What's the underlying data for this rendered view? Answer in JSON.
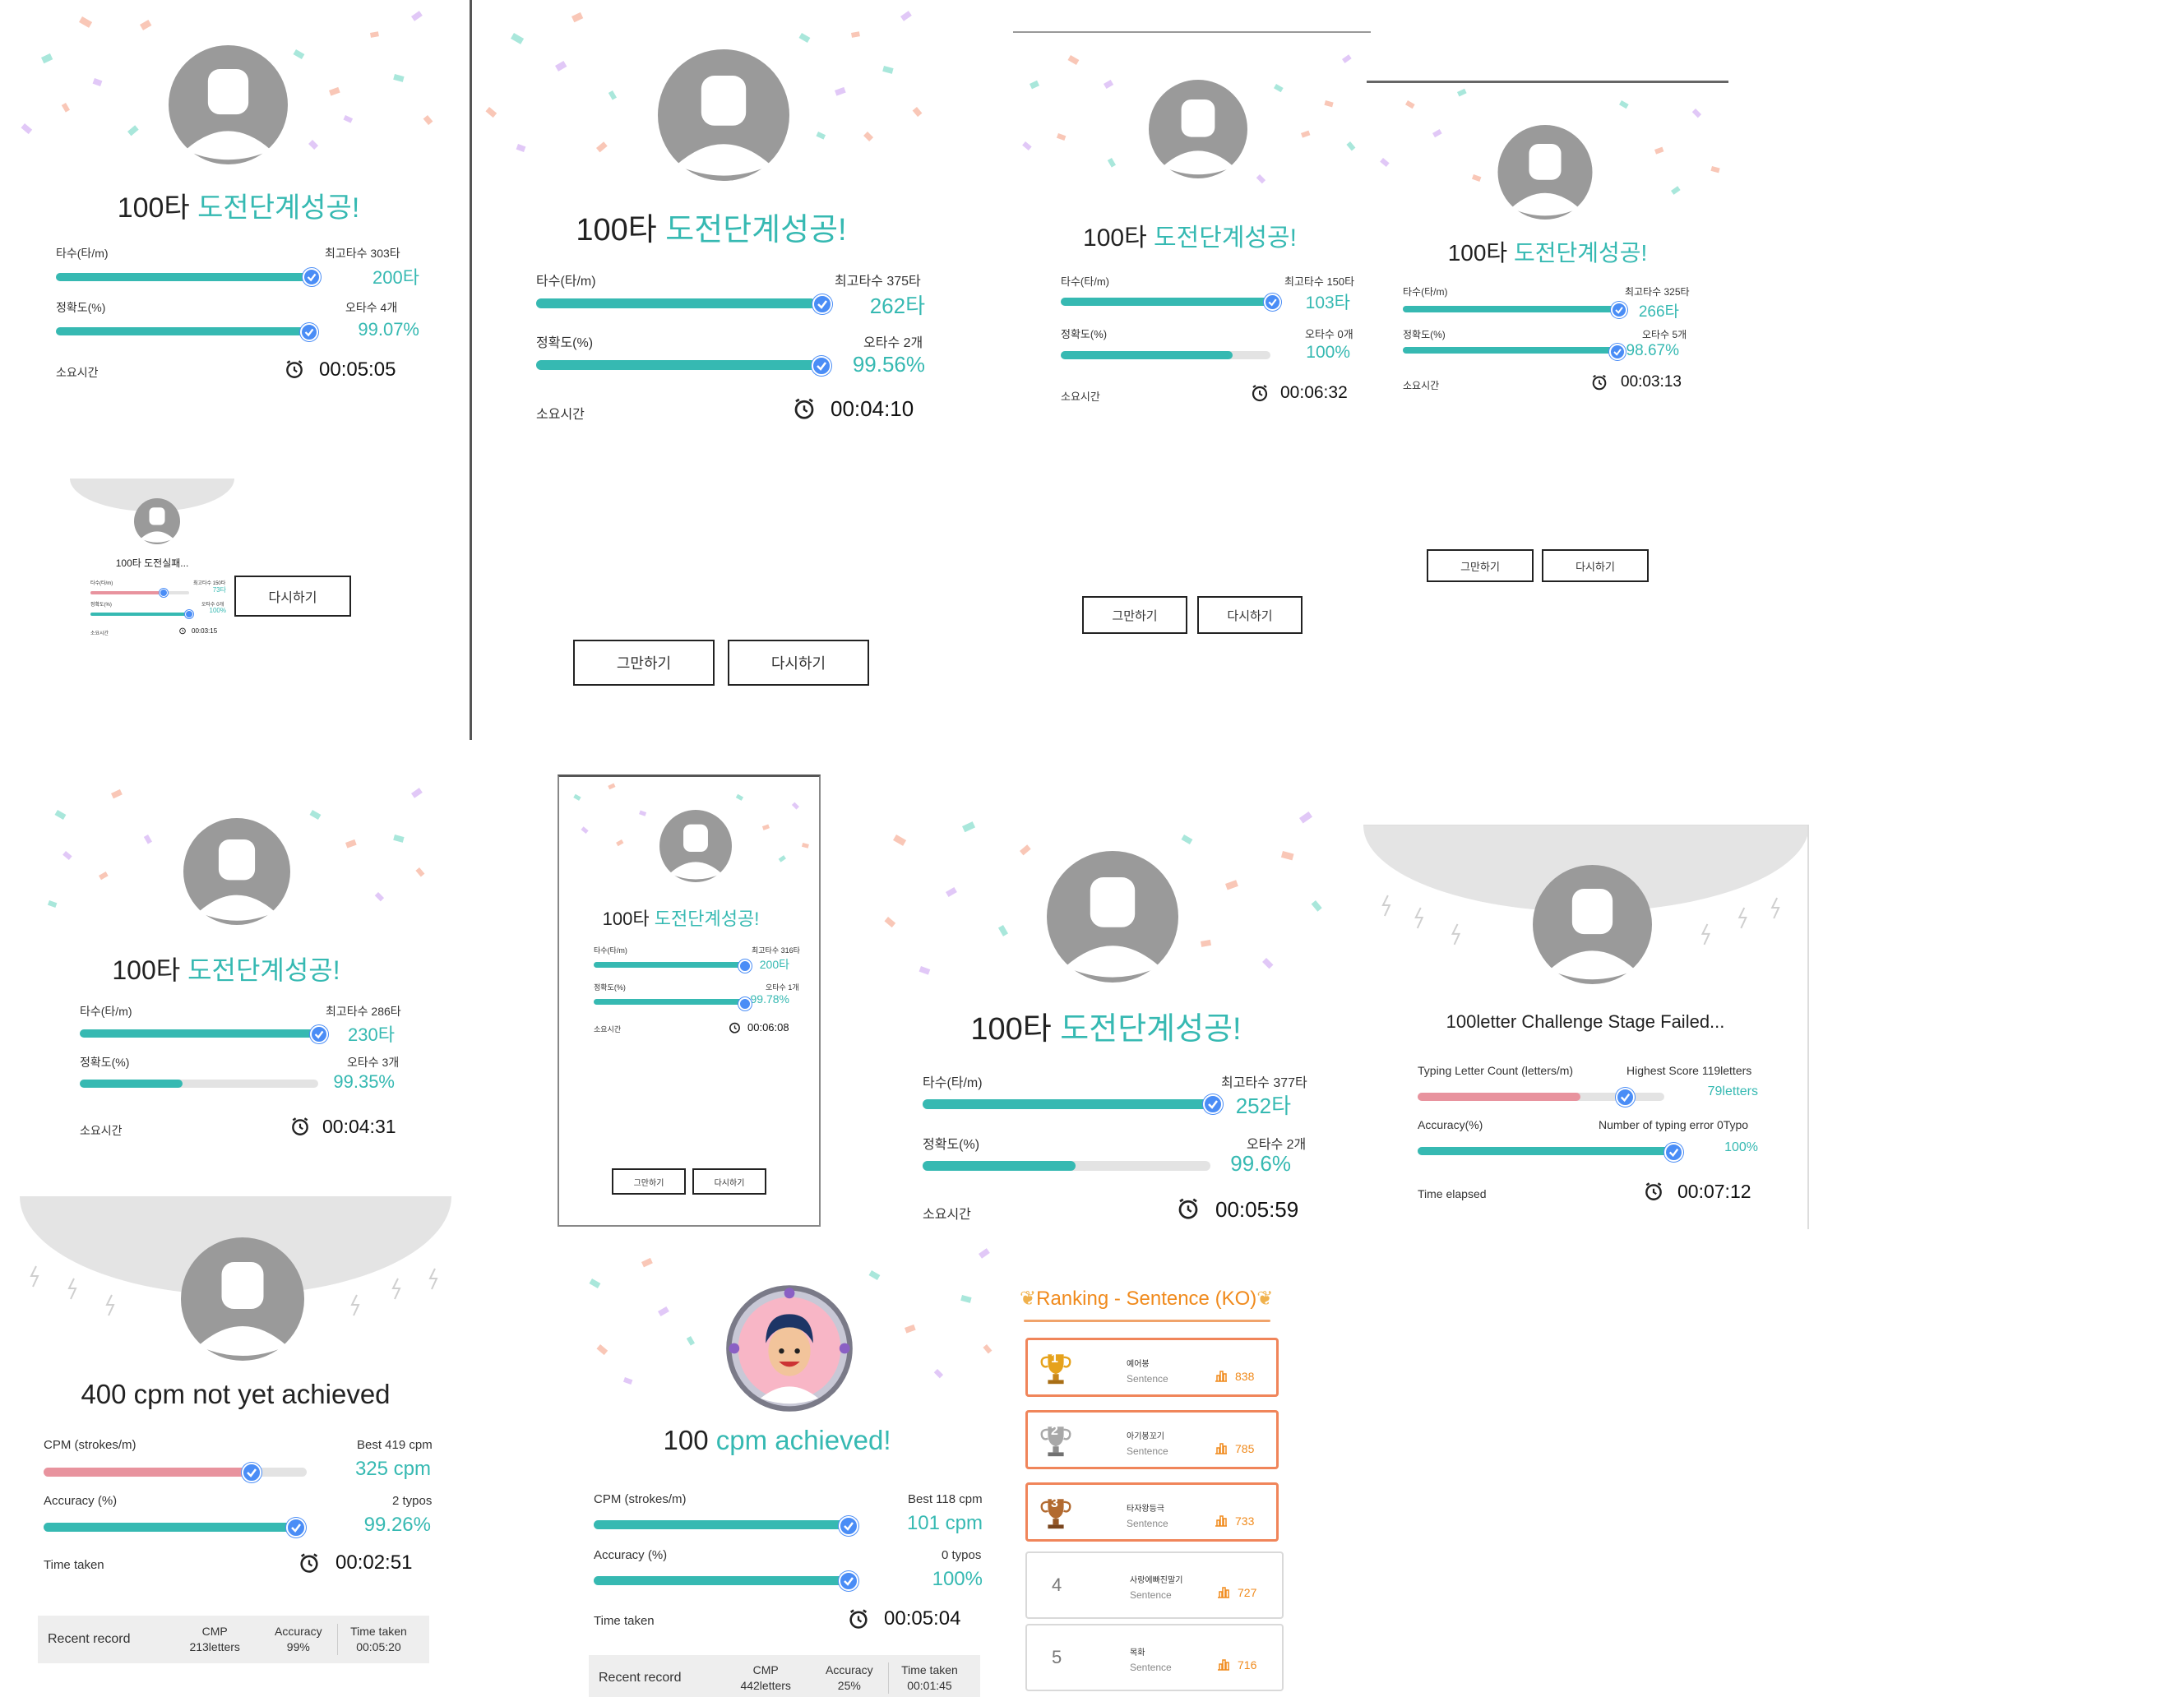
{
  "colors": {
    "accent": "#36b9b2",
    "fail_bar": "#e8939e",
    "check": "#4a8df6",
    "ranking": "#f08a1c"
  },
  "icons": {
    "avatar": "user-avatar-icon",
    "check": "check-circle-icon",
    "clock": "alarm-clock-icon",
    "trophy": "trophy-icon",
    "score": "bar-chart-icon"
  },
  "panels": [
    {
      "id": "ko-success-1",
      "headline_num": "100타",
      "headline_text": "도전단계성공!",
      "speed_label": "타수(타/m)",
      "speed_hint": "최고타수 303타",
      "speed_value": "200타",
      "speed_fill": 1.0,
      "acc_label": "정확도(%)",
      "acc_hint": "오타수 4개",
      "acc_value": "99.07%",
      "acc_fill": 1.0,
      "time_label": "소요시간",
      "time_value": "00:05:05"
    },
    {
      "id": "ko-success-2",
      "headline_num": "100타",
      "headline_text": "도전단계성공!",
      "speed_label": "타수(타/m)",
      "speed_hint": "최고타수 375타",
      "speed_value": "262타",
      "speed_fill": 1.0,
      "acc_label": "정확도(%)",
      "acc_hint": "오타수 2개",
      "acc_value": "99.56%",
      "acc_fill": 1.0,
      "time_label": "소요시간",
      "time_value": "00:04:10",
      "btn_quit": "그만하기",
      "btn_retry": "다시하기"
    },
    {
      "id": "ko-success-3",
      "headline_num": "100타",
      "headline_text": "도전단계성공!",
      "speed_label": "타수(타/m)",
      "speed_hint": "최고타수 150타",
      "speed_value": "103타",
      "speed_fill": 1.0,
      "acc_label": "정확도(%)",
      "acc_hint": "오타수 0개",
      "acc_value": "100%",
      "acc_fill": 0.82,
      "time_label": "소요시간",
      "time_value": "00:06:32",
      "btn_quit": "그만하기",
      "btn_retry": "다시하기"
    },
    {
      "id": "ko-success-4",
      "headline_num": "100타",
      "headline_text": "도전단계성공!",
      "speed_label": "타수(타/m)",
      "speed_hint": "최고타수 325타",
      "speed_value": "266타",
      "speed_fill": 1.0,
      "acc_label": "정확도(%)",
      "acc_hint": "오타수 5개",
      "acc_value": "98.67%",
      "acc_fill": 1.0,
      "time_label": "소요시간",
      "time_value": "00:03:13",
      "btn_quit": "그만하기",
      "btn_retry": "다시하기"
    },
    {
      "id": "ko-fail-mini",
      "headline_text": "100타 도전실패...",
      "speed_label": "타수(타/m)",
      "speed_hint": "최고타수 150타",
      "speed_value": "73타",
      "speed_fill": 0.7,
      "acc_label": "정확도(%)",
      "acc_hint": "오타수 0개",
      "acc_value": "100%",
      "acc_fill": 1.0,
      "time_label": "소요시간",
      "time_value": "00:03:15",
      "btn_retry": "다시하기"
    },
    {
      "id": "ko-success-5",
      "headline_num": "100타",
      "headline_text": "도전단계성공!",
      "speed_label": "타수(타/m)",
      "speed_hint": "최고타수 286타",
      "speed_value": "230타",
      "speed_fill": 1.0,
      "acc_label": "정확도(%)",
      "acc_hint": "오타수 3개",
      "acc_value": "99.35%",
      "acc_fill": 0.43,
      "time_label": "소요시간",
      "time_value": "00:04:31"
    },
    {
      "id": "ko-success-6",
      "headline_num": "100타",
      "headline_text": "도전단계성공!",
      "speed_label": "타수(타/m)",
      "speed_hint": "최고타수 316타",
      "speed_value": "200타",
      "speed_fill": 1.0,
      "acc_label": "정확도(%)",
      "acc_hint": "오타수 1개",
      "acc_value": "99.78%",
      "acc_fill": 1.0,
      "time_label": "소요시간",
      "time_value": "00:06:08",
      "btn_quit": "그만하기",
      "btn_retry": "다시하기"
    },
    {
      "id": "ko-success-7",
      "headline_num": "100타",
      "headline_text": "도전단계성공!",
      "speed_label": "타수(타/m)",
      "speed_hint": "최고타수 377타",
      "speed_value": "252타",
      "speed_fill": 1.0,
      "acc_label": "정확도(%)",
      "acc_hint": "오타수 2개",
      "acc_value": "99.6%",
      "acc_fill": 0.53,
      "time_label": "소요시간",
      "time_value": "00:05:59"
    },
    {
      "id": "en-fail-letters",
      "headline_text": "100letter Challenge Stage Failed...",
      "speed_label": "Typing Letter Count (letters/m)",
      "speed_hint": "Highest Score 119letters",
      "speed_value": "79letters",
      "speed_fill": 0.66,
      "acc_label": "Accuracy(%)",
      "acc_hint": "Number of typing error 0Typo",
      "acc_value": "100%",
      "acc_fill": 1.0,
      "time_label": "Time elapsed",
      "time_value": "00:07:12"
    },
    {
      "id": "en-fail-cpm",
      "headline_text": "400 cpm not yet achieved",
      "speed_label": "CPM (strokes/m)",
      "speed_hint": "Best 419 cpm",
      "speed_value": "325 cpm",
      "speed_fill": 0.79,
      "acc_label": "Accuracy (%)",
      "acc_hint": "2 typos",
      "acc_value": "99.26%",
      "acc_fill": 1.0,
      "time_label": "Time taken",
      "time_value": "00:02:51",
      "recent": {
        "label": "Recent record",
        "c1_head": "CMP",
        "c1_val": "213letters",
        "c2_head": "Accuracy",
        "c2_val": "99%",
        "c3_head": "Time taken",
        "c3_val": "00:05:20"
      }
    },
    {
      "id": "en-success-cpm",
      "headline_num": "100",
      "headline_text": "cpm achieved!",
      "speed_label": "CPM (strokes/m)",
      "speed_hint": "Best 118 cpm",
      "speed_value": "101 cpm",
      "speed_fill": 1.0,
      "acc_label": "Accuracy (%)",
      "acc_hint": "0 typos",
      "acc_value": "100%",
      "acc_fill": 1.0,
      "time_label": "Time taken",
      "time_value": "00:05:04",
      "recent": {
        "label": "Recent record",
        "c1_head": "CMP",
        "c1_val": "442letters",
        "c2_head": "Accuracy",
        "c2_val": "25%",
        "c3_head": "Time taken",
        "c3_val": "00:01:45"
      }
    }
  ],
  "ranking": {
    "title": "Ranking - Sentence (KO)",
    "rows": [
      {
        "rank": "1",
        "name": "예어봉",
        "type": "Sentence",
        "score": "838"
      },
      {
        "rank": "2",
        "name": "아기봉꼬기",
        "type": "Sentence",
        "score": "785"
      },
      {
        "rank": "3",
        "name": "타자왕등극",
        "type": "Sentence",
        "score": "733"
      },
      {
        "rank": "4",
        "name": "사랑에빠진말기",
        "type": "Sentence",
        "score": "727"
      },
      {
        "rank": "5",
        "name": "목화",
        "type": "Sentence",
        "score": "716"
      }
    ]
  }
}
